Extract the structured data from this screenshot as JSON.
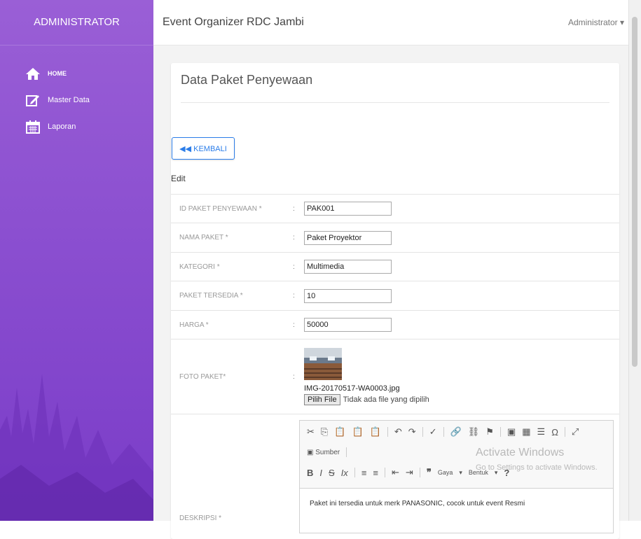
{
  "sidebar": {
    "brand": "ADMINISTRATOR",
    "items": [
      {
        "label": "HOME",
        "icon": "home-icon"
      },
      {
        "label": "Master Data",
        "icon": "edit-icon"
      },
      {
        "label": "Laporan",
        "icon": "calendar-icon"
      }
    ]
  },
  "topbar": {
    "title": "Event Organizer RDC Jambi",
    "user": "Administrator ▾"
  },
  "card": {
    "title": "Data Paket Penyewaan",
    "back_button": "◀◀ KEMBALI",
    "mode_label": "Edit",
    "separator": ":",
    "fields": [
      {
        "label": "ID PAKET PENYEWAAN *",
        "value": "PAK001"
      },
      {
        "label": "NAMA PAKET *",
        "value": "Paket Proyektor"
      },
      {
        "label": "KATEGORI *",
        "value": "Multimedia"
      },
      {
        "label": "PAKET TERSEDIA *",
        "value": "10"
      },
      {
        "label": "HARGA *",
        "value": "50000"
      }
    ],
    "photo": {
      "label": "FOTO PAKET*",
      "filename": "IMG-20170517-WA0003.jpg",
      "choose_button": "Pilih File",
      "no_file_text": "Tidak ada file yang dipilih"
    },
    "description": {
      "label": "DESKRIPSI *",
      "source_button": "Sumber",
      "style_dropdown": "Gaya",
      "format_dropdown": "Bentuk",
      "content": "Paket ini tersedia untuk merk PANASONIC, cocok untuk event Resmi"
    }
  },
  "watermark": {
    "line1": "Activate Windows",
    "line2": "Go to Settings to activate Windows."
  },
  "colors": {
    "sidebar": "#8b4fd0",
    "accent": "#2b7de9"
  }
}
